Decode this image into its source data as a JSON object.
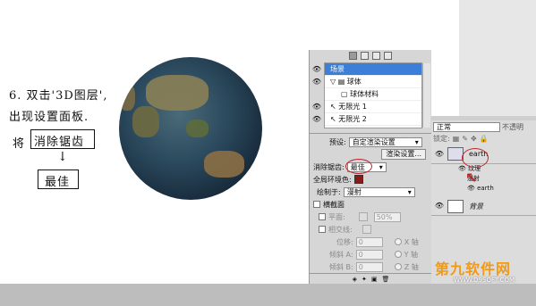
{
  "annotation": {
    "line1": "6. 双击'3D图层',",
    "line2": "出现设置面板.",
    "line3_prefix": "将",
    "line3_boxed": "消除锯齿",
    "arrow": "↓",
    "result": "最佳"
  },
  "panel3d": {
    "scene_items": [
      "场景",
      "球体",
      "球体材料",
      "无限光 1",
      "无限光 2"
    ],
    "preset_label": "预设:",
    "preset_value": "自定渲染设置",
    "render_button": "渲染设置...",
    "antialias_label": "消除锯齿:",
    "antialias_value": "最佳",
    "global_ambient_label": "全局环境色:",
    "paint_on_label": "绘制于:",
    "paint_on_value": "漫射",
    "cross_section_label": "横截面",
    "plane_label": "平面:",
    "plane_percent": "50%",
    "intersect_label": "相交线:",
    "offset_label": "位移:",
    "offset_value": "0",
    "tilt_a_label": "倾斜 A:",
    "tilt_a_value": "0",
    "tilt_b_label": "倾斜 B:",
    "tilt_b_value": "0",
    "axis_x": "X 轴",
    "axis_y": "Y 轴",
    "axis_z": "Z 轴"
  },
  "layers": {
    "blend_mode": "正常",
    "opacity_label": "不透明",
    "lock_label": "锁定:",
    "layer_earth": "earth",
    "texture_group": "纹理",
    "diffuse": "漫射",
    "texture_earth": "earth",
    "background": "背景"
  },
  "watermark": {
    "main": "第九软件网",
    "sub": "WWW.D9SOFT.COM"
  },
  "colors": {
    "selection_blue": "#3b7fd9",
    "ambient_swatch": "#8a1a1a",
    "annotation_red": "#c0262a",
    "watermark_orange": "#f09a18"
  }
}
